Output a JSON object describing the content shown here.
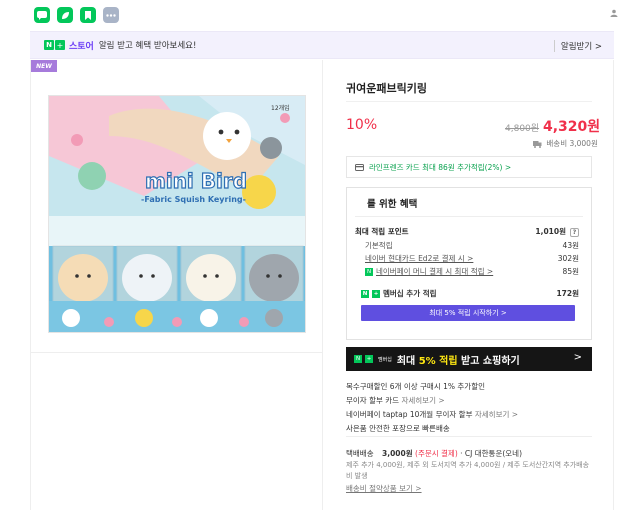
{
  "colors": {
    "accent_purple": "#6b3cf6",
    "naver_green": "#03c75a",
    "price_red": "#f0304a",
    "member_purple": "#5f4fe0"
  },
  "topbar": {
    "icons": [
      "talk-icon",
      "leaf-icon",
      "bookmark-icon",
      "more-icon"
    ]
  },
  "banner": {
    "n_badge": "N",
    "plus_badge": "+",
    "store": "스토어",
    "message": "알림 받고 혜택 받아보세요!",
    "right": "알림받기 >"
  },
  "product": {
    "badge": "NEW",
    "title": "귀여운패브릭키링",
    "image_text": {
      "brand": "mini Bird",
      "sub": "-Fabric Squish Keyring-",
      "count": "12개입"
    },
    "discount": "10%",
    "original_price": "4,800원",
    "price": "4,320원",
    "shipping_note": "배송비 3,000원",
    "card_text": "라인프렌즈 카드 최대 86원 추가적립(2%) >"
  },
  "benefit": {
    "title": "를 위한 혜택",
    "max_points_label": "최대 적립 포인트",
    "max_points_value": "1,010원",
    "question_mark": "?",
    "rows": [
      {
        "label": "기본적립",
        "value": "43원"
      },
      {
        "label": "네이버 현대카드 Ed2로 결제 시 >",
        "value": "302원"
      },
      {
        "label": "네이버페이 머니 결제 시 최대 적립 >",
        "value": "85원"
      }
    ],
    "member_label": "멤버십 추가 적립",
    "member_value": "172원",
    "member_button": "최대 5% 적립 시작하기 >"
  },
  "black_banner": {
    "tag": "멤버십",
    "text_pre": "최대 ",
    "text_highlight": "5% 적립",
    "text_post": " 받고 쇼핑하기",
    "arrow": ">"
  },
  "info": [
    {
      "label": "복수구매할인  6개 이상 구매시 1% 추가할인",
      "link": ""
    },
    {
      "label": "무이자 할부 카드",
      "link": "자세히보기 >"
    },
    {
      "label": "네이버페이 taptap 10개월 무이자 할부",
      "link": "자세히보기 >"
    },
    {
      "label": "사은품  안전한 포장으로 빠른배송",
      "link": ""
    }
  ],
  "shipping": {
    "label": "택배배송",
    "price": "3,000원",
    "price_note": "(주문시 결제)",
    "carrier": "· CJ 대한통운(오네)",
    "line1": "제주 추가 4,000원, 제주 외 도서지역 추가 4,000원 / 제주 도서산간지역 추가배송",
    "line2": "비 발생",
    "link": "배송비 절약상품 보기 >"
  }
}
